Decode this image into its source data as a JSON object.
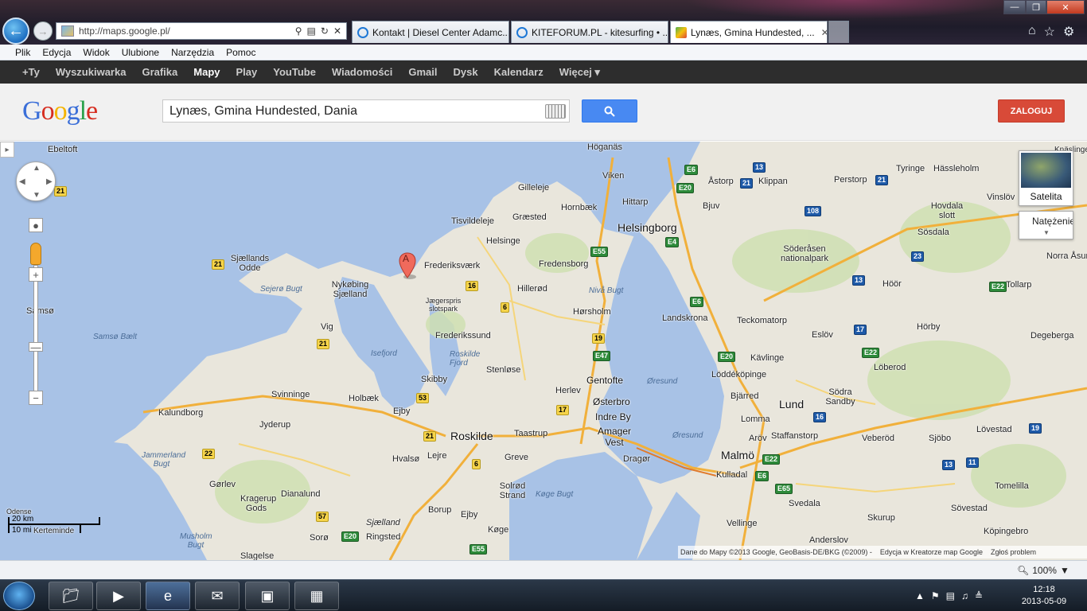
{
  "browser": {
    "address": "http://maps.google.pl/",
    "tabs": [
      {
        "label": "Kontakt | Diesel Center Adamc..."
      },
      {
        "label": "KITEFORUM.PL - kitesurfing • ..."
      },
      {
        "label": "Lynæs, Gmina Hundested, ..."
      }
    ],
    "menu": [
      "Plik",
      "Edycja",
      "Widok",
      "Ulubione",
      "Narzędzia",
      "Pomoc"
    ]
  },
  "google_bar": {
    "items": [
      "+Ty",
      "Wyszukiwarka",
      "Grafika",
      "Mapy",
      "Play",
      "YouTube",
      "Wiadomości",
      "Gmail",
      "Dysk",
      "Kalendarz",
      "Więcej ▾"
    ],
    "active": "Mapy"
  },
  "header": {
    "logo": [
      "G",
      "o",
      "o",
      "g",
      "l",
      "e"
    ],
    "search_value": "Lynæs, Gmina Hundested, Dania",
    "login_label": "ZALOGUJ"
  },
  "map": {
    "marker_label": "A",
    "satellite_label": "Satelita",
    "traffic_label": "Natężenie",
    "scale_km": "20 km",
    "scale_mi": "10 mi",
    "copyright": "Dane do Mapy ©2013 Google, GeoBasis-DE/BKG (©2009) -",
    "edit_link": "Edycja w Kreatorze map Google",
    "report_link": "Zgłoś problem",
    "places": [
      {
        "t": "Ebeltoft"
      },
      {
        "t": "Höganäs"
      },
      {
        "t": "Viken"
      },
      {
        "t": "Gilleleje"
      },
      {
        "t": "Hornbæk"
      },
      {
        "t": "Hittarp"
      },
      {
        "t": "Bjuv"
      },
      {
        "t": "Åstorp"
      },
      {
        "t": "Klippan"
      },
      {
        "t": "Perstorp"
      },
      {
        "t": "Tyringe"
      },
      {
        "t": "Hässleholm"
      },
      {
        "t": "Vinslöv"
      },
      {
        "t": "Tisvildeleje"
      },
      {
        "t": "Græsted"
      },
      {
        "t": "Helsinge"
      },
      {
        "t": "Helsingborg"
      },
      {
        "t": "Hovdala slott"
      },
      {
        "t": "Sösdala"
      },
      {
        "t": "Sjællands Odde"
      },
      {
        "t": "Frederiksværk"
      },
      {
        "t": "Fredensborg"
      },
      {
        "t": "Söderåsen nationalpark"
      },
      {
        "t": "Norra Åsum"
      },
      {
        "t": "Nykøbing Sjælland"
      },
      {
        "t": "Hillerød"
      },
      {
        "t": "Höör"
      },
      {
        "t": "Tollarp"
      },
      {
        "t": "Jægerspris slotspark"
      },
      {
        "t": "Hørsholm"
      },
      {
        "t": "Samsø"
      },
      {
        "t": "Vig"
      },
      {
        "t": "Landskrona"
      },
      {
        "t": "Teckomatorp"
      },
      {
        "t": "Frederikssund"
      },
      {
        "t": "Eslöv"
      },
      {
        "t": "Hörby"
      },
      {
        "t": "Degeberga"
      },
      {
        "t": "Kävlinge"
      },
      {
        "t": "Stenløse"
      },
      {
        "t": "Löberod"
      },
      {
        "t": "Skibby"
      },
      {
        "t": "Gentofte"
      },
      {
        "t": "Löddéköpinge"
      },
      {
        "t": "Herlev"
      },
      {
        "t": "Svinninge"
      },
      {
        "t": "Holbæk"
      },
      {
        "t": "Østerbro"
      },
      {
        "t": "Bjärred"
      },
      {
        "t": "Södra Sandby"
      },
      {
        "t": "Ejby"
      },
      {
        "t": "Indre By"
      },
      {
        "t": "Lund"
      },
      {
        "t": "Kalundborg"
      },
      {
        "t": "Lomma"
      },
      {
        "t": "Jyderup"
      },
      {
        "t": "Roskilde"
      },
      {
        "t": "Taastrup"
      },
      {
        "t": "Amager Vest"
      },
      {
        "t": "Aröv"
      },
      {
        "t": "Staffanstorp"
      },
      {
        "t": "Veberöd"
      },
      {
        "t": "Sjöbo"
      },
      {
        "t": "Lövestad"
      },
      {
        "t": "Hvalsø"
      },
      {
        "t": "Lejre"
      },
      {
        "t": "Greve"
      },
      {
        "t": "Dragør"
      },
      {
        "t": "Malmö"
      },
      {
        "t": "Gørlev"
      },
      {
        "t": "Kulladal"
      },
      {
        "t": "Dianalund"
      },
      {
        "t": "Solrød Strand"
      },
      {
        "t": "Svedala"
      },
      {
        "t": "Tomelilla"
      },
      {
        "t": "Kragerup Gods"
      },
      {
        "t": "Borup"
      },
      {
        "t": "Ejby"
      },
      {
        "t": "Skurup"
      },
      {
        "t": "Sövestad"
      },
      {
        "t": "Vellinge"
      },
      {
        "t": "Sjælland"
      },
      {
        "t": "Sorø"
      },
      {
        "t": "Ringsted"
      },
      {
        "t": "Køge"
      },
      {
        "t": "Anderslov"
      },
      {
        "t": "Köpingebro"
      },
      {
        "t": "Slagelse"
      },
      {
        "t": "Kerteminde"
      },
      {
        "t": "Odense"
      },
      {
        "t": "Musholm Bugt"
      },
      {
        "t": "Knäslinge"
      }
    ],
    "waters": [
      {
        "t": "Sejerø Bugt"
      },
      {
        "t": "Samsø Bælt"
      },
      {
        "t": "Isefjord"
      },
      {
        "t": "Roskilde Fjord"
      },
      {
        "t": "Nivå Bugt"
      },
      {
        "t": "Øresund"
      },
      {
        "t": "Jammerland Bugt"
      },
      {
        "t": "Køge Bugt"
      }
    ],
    "shields": [
      {
        "t": "21"
      },
      {
        "t": "E6"
      },
      {
        "t": "13"
      },
      {
        "t": "E20"
      },
      {
        "t": "21"
      },
      {
        "t": "21"
      },
      {
        "t": "108"
      },
      {
        "t": "E4"
      },
      {
        "t": "E55"
      },
      {
        "t": "16"
      },
      {
        "t": "23"
      },
      {
        "t": "13"
      },
      {
        "t": "E22"
      },
      {
        "t": "6"
      },
      {
        "t": "E6"
      },
      {
        "t": "21"
      },
      {
        "t": "19"
      },
      {
        "t": "17"
      },
      {
        "t": "E47"
      },
      {
        "t": "E20"
      },
      {
        "t": "E22"
      },
      {
        "t": "21"
      },
      {
        "t": "53"
      },
      {
        "t": "17"
      },
      {
        "t": "16"
      },
      {
        "t": "19"
      },
      {
        "t": "21"
      },
      {
        "t": "22"
      },
      {
        "t": "6"
      },
      {
        "t": "E22"
      },
      {
        "t": "E6"
      },
      {
        "t": "13"
      },
      {
        "t": "11"
      },
      {
        "t": "E65"
      },
      {
        "t": "57"
      },
      {
        "t": "E20"
      },
      {
        "t": "E55"
      }
    ]
  },
  "status": {
    "zoom": "100%"
  },
  "taskbar": {
    "time": "12:18",
    "date": "2013-05-09"
  },
  "colors": {
    "water": "#a8c2e6",
    "land": "#e9e6dc",
    "green": "#cfdfb2",
    "road": "#f1b03b",
    "accent": "#4889f2",
    "login": "#d84a38"
  }
}
